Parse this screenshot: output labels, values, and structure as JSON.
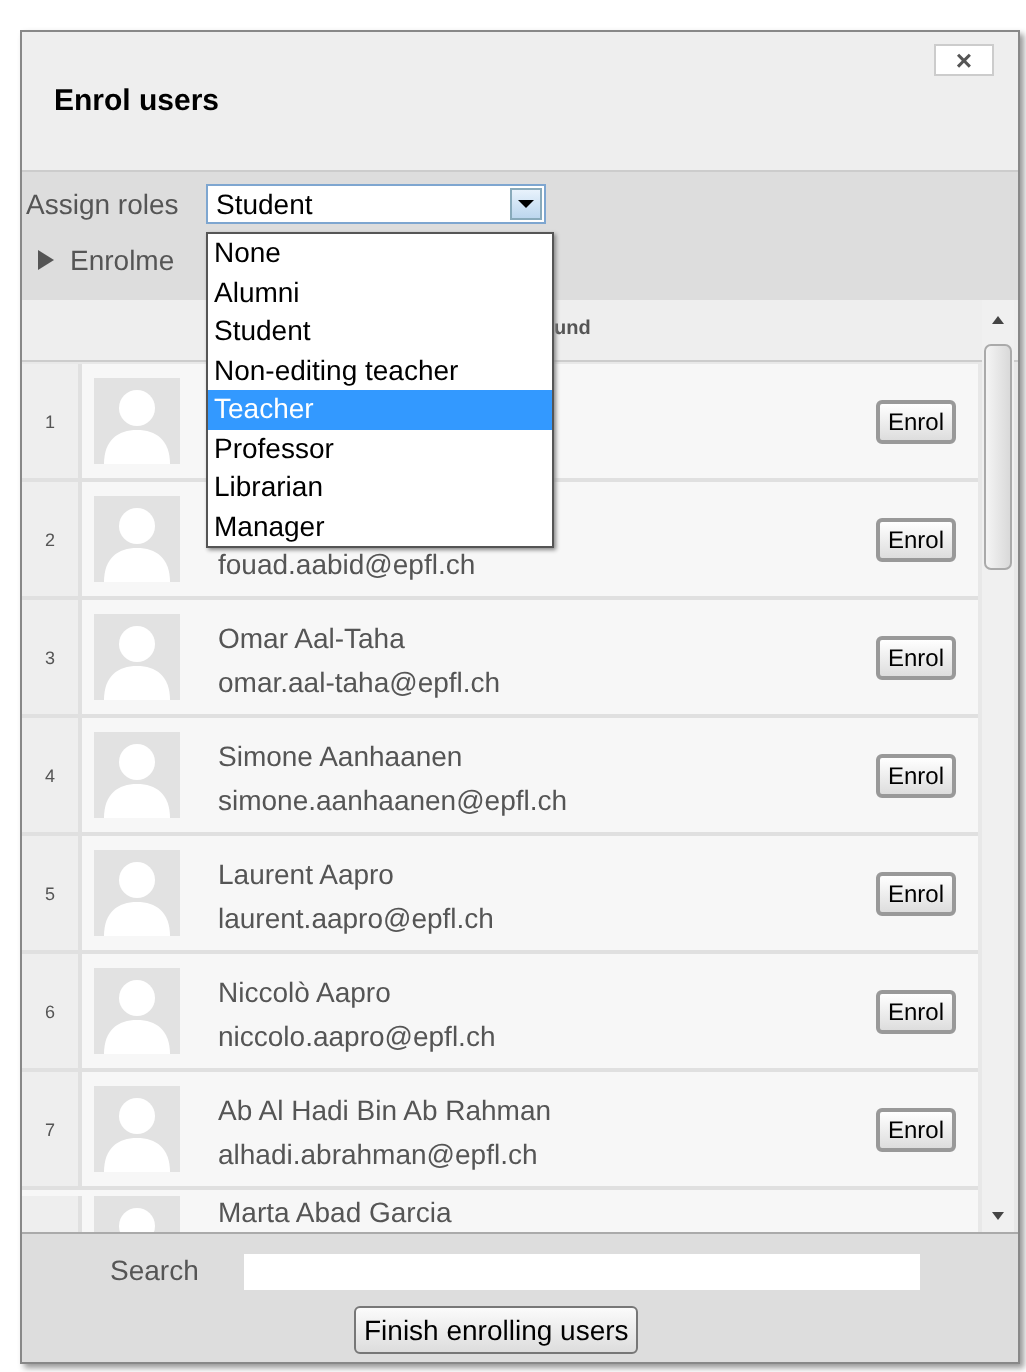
{
  "dialog": {
    "title": "Enrol users",
    "close": "×"
  },
  "toolbar": {
    "assign_label": "Assign roles",
    "role_value": "Student",
    "enrolment_label": "Enrolme",
    "role_options": [
      {
        "label": "None",
        "selected": false
      },
      {
        "label": "Alumni",
        "selected": false
      },
      {
        "label": "Student",
        "selected": false
      },
      {
        "label": "Non-editing teacher",
        "selected": false
      },
      {
        "label": "Teacher",
        "selected": true
      },
      {
        "label": "Professor",
        "selected": false
      },
      {
        "label": "Librarian",
        "selected": false
      },
      {
        "label": "Manager",
        "selected": false
      }
    ]
  },
  "list": {
    "header": "und",
    "rows": [
      {
        "number": "1",
        "button": "Enrol"
      },
      {
        "number": "2",
        "email": "fouad.aabid@epfl.ch",
        "button": "Enrol"
      },
      {
        "number": "3",
        "name": "Omar Aal-Taha",
        "email": "omar.aal-taha@epfl.ch",
        "button": "Enrol"
      },
      {
        "number": "4",
        "name": "Simone Aanhaanen",
        "email": "simone.aanhaanen@epfl.ch",
        "button": "Enrol"
      },
      {
        "number": "5",
        "name": "Laurent Aapro",
        "email": "laurent.aapro@epfl.ch",
        "button": "Enrol"
      },
      {
        "number": "6",
        "name": "Niccolò Aapro",
        "email": "niccolo.aapro@epfl.ch",
        "button": "Enrol"
      },
      {
        "number": "7",
        "name": "Ab Al Hadi Bin Ab Rahman",
        "email": "alhadi.abrahman@epfl.ch",
        "button": "Enrol"
      },
      {
        "name": "Marta Abad Garcia"
      }
    ]
  },
  "footer": {
    "search_label": "Search",
    "finish_button": "Finish enrolling users"
  }
}
